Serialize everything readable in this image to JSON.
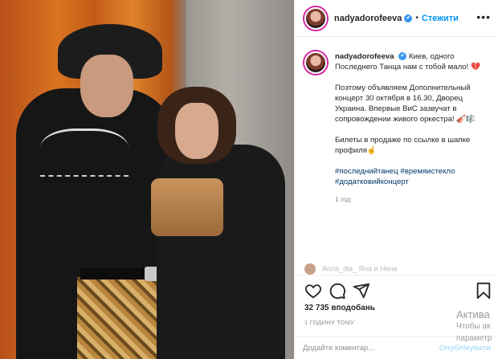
{
  "post": {
    "username": "nadyadorofeeva",
    "verified": "✔",
    "follow_label": "Стежити",
    "more_label": "•••",
    "caption_intro": "Киев, одного Последнего Танца нам с тобой мало! 💔",
    "caption_para2": "Поэтому объявляем Дополнительный концерт 30 октября в 16.30, Дворец Украина. Впервые ВиС зазвучат в сопровождении живого оркестра! 🎻🎼",
    "caption_para3": "Билеты в продаже по ссылке в шапке профиля☝️",
    "hashtags": "#последнийтанец #времяистекло #додатковийконцерт",
    "caption_age": "1 год",
    "comment_peek": "Anna_dia_ Яна и Нина",
    "likes": "32 735 вподобань",
    "time_ago": "1 ГОДИНУ ТОМУ",
    "add_comment_placeholder": "Додайте коментар...",
    "publish_label": "Опублікувати"
  },
  "icons": {
    "like": "heart-icon",
    "comment": "comment-icon",
    "share": "share-icon",
    "save": "bookmark-icon"
  },
  "watermark": {
    "line1": "Актива",
    "line2": "Чтобы ак",
    "line3": "параметр"
  }
}
